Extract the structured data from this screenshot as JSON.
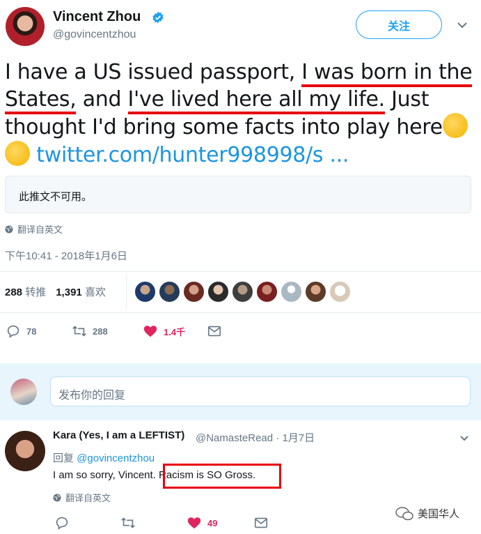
{
  "author": {
    "name": "Vincent Zhou",
    "handle": "@govincentzhou",
    "follow_label": "关注"
  },
  "tweet": {
    "text_part1": "I have a US issued passport, ",
    "text_ul1a": "I was born in the",
    "text_ul1b": "States,",
    "text_part2": " and ",
    "text_ul2": "I've lived here all my life.",
    "text_part3": " Just thought I'd bring some facts into play here",
    "link": "twitter.com/hunter998998/s ...",
    "quoted_unavailable": "此推文不可用。",
    "translate_label": "翻译自英文",
    "timestamp": "下午10:41 - 2018年1月6日"
  },
  "stats": {
    "retweets_count": "288",
    "retweets_label": "转推",
    "likes_count": "1,391",
    "likes_label": "喜欢"
  },
  "actions": {
    "reply_count": "78",
    "retweet_count": "288",
    "like_count": "1.4千"
  },
  "reply_box": {
    "placeholder": "发布你的回复"
  },
  "reply": {
    "name": "Kara (Yes, I am a LEFTIST)",
    "meta": "@NamasteRead · 1月7日",
    "reply_prefix": "回复 ",
    "reply_to": "@govincentzhou",
    "text": "I am so sorry, Vincent. Racism is SO Gross.",
    "translate_label": "翻译自英文",
    "like_count": "49"
  },
  "watermark": {
    "text": "美国华人"
  },
  "colors": {
    "accent": "#1da1f2",
    "like": "#e0245e",
    "highlight": "#e8000b"
  }
}
